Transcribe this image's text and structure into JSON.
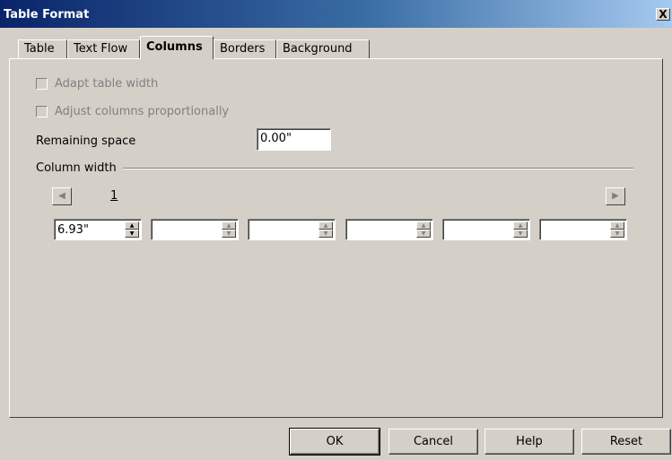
{
  "window": {
    "title": "Table Format",
    "close_glyph": "X"
  },
  "tabs": [
    {
      "label": "Table",
      "active": false
    },
    {
      "label": "Text Flow",
      "active": false
    },
    {
      "label": "Columns",
      "active": true
    },
    {
      "label": "Borders",
      "active": false
    },
    {
      "label": "Background",
      "active": false
    }
  ],
  "options": {
    "adapt_table_width": "Adapt table width",
    "adjust_columns_proportionally": "Adjust columns proportionally"
  },
  "remaining_space": {
    "label": "Remaining space",
    "value": "0.00\""
  },
  "column_width": {
    "label": "Column width",
    "column_number": "1",
    "prev_icon": "arrow-left-icon",
    "next_icon": "arrow-right-icon",
    "values": [
      "6.93\"",
      "",
      "",
      "",
      "",
      ""
    ]
  },
  "buttons": {
    "ok": "OK",
    "cancel": "Cancel",
    "help": "Help",
    "reset": "Reset"
  }
}
